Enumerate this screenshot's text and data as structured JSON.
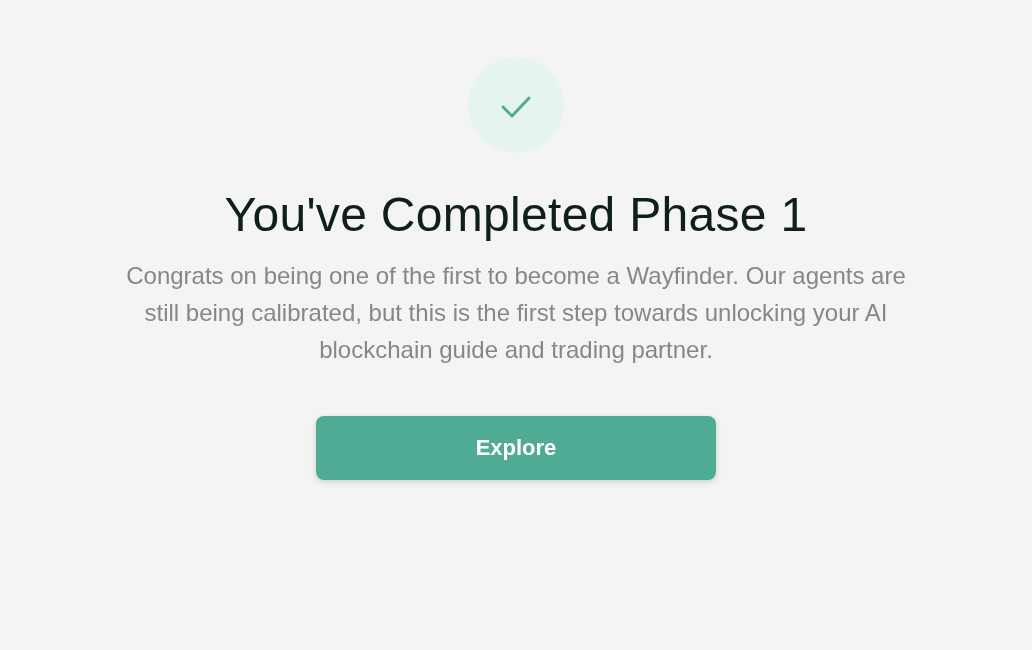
{
  "badge": {
    "kind": "check"
  },
  "title": "You've Completed Phase 1",
  "message": "Congrats on being one of the first to become a Wayfinder. Our agents are still being calibrated, but this is the first step towards unlocking your AI blockchain guide and trading partner.",
  "button": {
    "label": "Explore"
  }
}
